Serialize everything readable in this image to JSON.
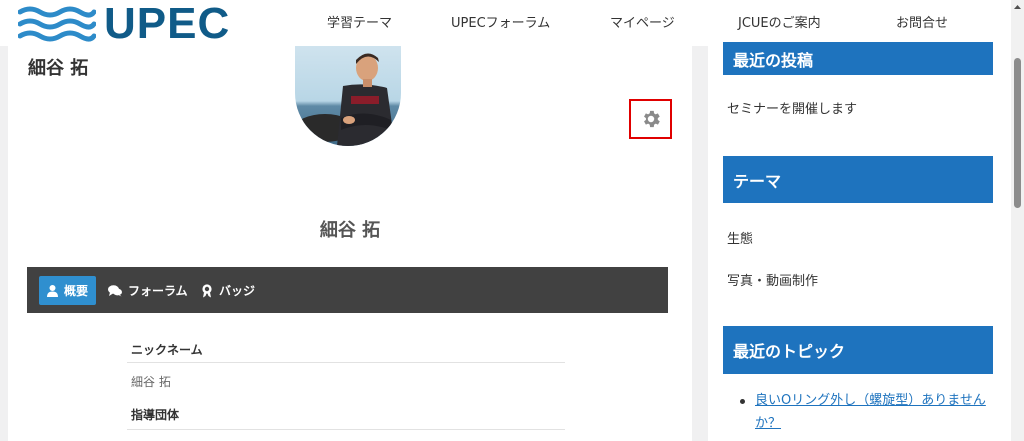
{
  "header": {
    "logo_text": "UPEC",
    "nav": [
      "学習テーマ",
      "UPECフォーラム",
      "マイページ",
      "JCUEのご案内",
      "お問合せ"
    ]
  },
  "profile": {
    "page_title": "細谷 拓",
    "name": "細谷 拓",
    "tabs": [
      {
        "label": "概要",
        "icon": "user-icon"
      },
      {
        "label": "フォーラム",
        "icon": "comments-icon"
      },
      {
        "label": "バッジ",
        "icon": "award-badge-icon"
      }
    ],
    "fields": [
      {
        "label": "ニックネーム",
        "value": "細谷 拓"
      },
      {
        "label": "指導団体",
        "value": ""
      }
    ]
  },
  "sidebar": {
    "recent_posts": {
      "title": "最近の投稿",
      "items": [
        "セミナーを開催します"
      ]
    },
    "themes": {
      "title": "テーマ",
      "items": [
        "生態",
        "写真・動画制作"
      ]
    },
    "recent_topics": {
      "title": "最近のトピック",
      "items": [
        "良いOリング外し（螺旋型）ありませんか？"
      ]
    }
  },
  "colors": {
    "brand_blue": "#105b88",
    "widget_blue": "#1e73be",
    "tab_active": "#2f8fcf",
    "tabbar_bg": "#414141",
    "highlight_red": "#e00000"
  }
}
